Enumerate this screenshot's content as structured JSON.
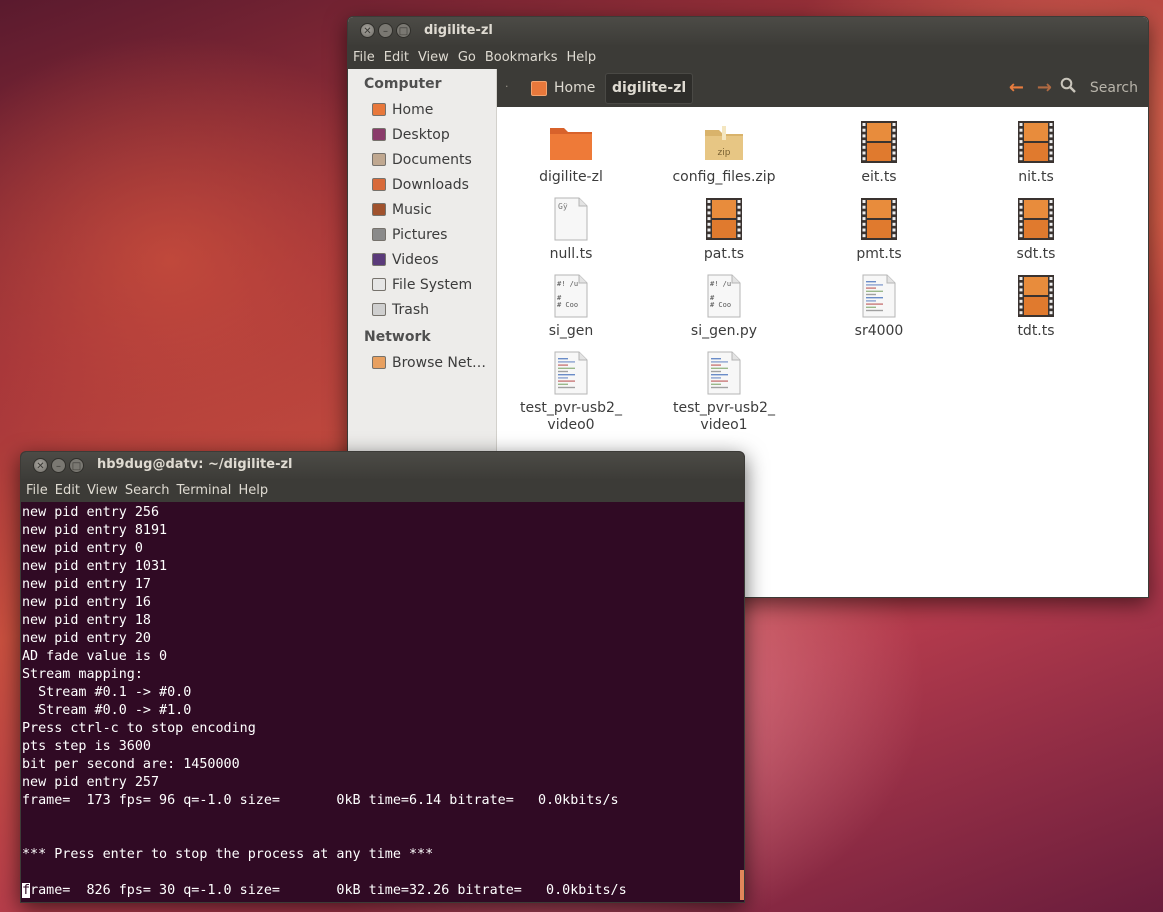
{
  "file_manager": {
    "title": "digilite-zl",
    "menu": [
      "File",
      "Edit",
      "View",
      "Go",
      "Bookmarks",
      "Help"
    ],
    "breadcrumb": {
      "home": "Home",
      "current": "digilite-zl"
    },
    "search_label": "Search",
    "sidebar": {
      "computer_heading": "Computer",
      "computer_items": [
        {
          "label": "Home",
          "icon": "home-icon"
        },
        {
          "label": "Desktop",
          "icon": "desktop-icon"
        },
        {
          "label": "Documents",
          "icon": "documents-icon"
        },
        {
          "label": "Downloads",
          "icon": "downloads-icon"
        },
        {
          "label": "Music",
          "icon": "music-icon"
        },
        {
          "label": "Pictures",
          "icon": "pictures-icon"
        },
        {
          "label": "Videos",
          "icon": "videos-icon"
        },
        {
          "label": "File System",
          "icon": "drive-icon"
        },
        {
          "label": "Trash",
          "icon": "trash-icon"
        }
      ],
      "network_heading": "Network",
      "network_items": [
        {
          "label": "Browse Net…",
          "icon": "network-icon"
        }
      ]
    },
    "files": [
      {
        "name": "digilite-zl",
        "type": "folder"
      },
      {
        "name": "config_files.zip",
        "type": "zip"
      },
      {
        "name": "eit.ts",
        "type": "video"
      },
      {
        "name": "nit.ts",
        "type": "video"
      },
      {
        "name": "null.ts",
        "type": "binary"
      },
      {
        "name": "pat.ts",
        "type": "video"
      },
      {
        "name": "pmt.ts",
        "type": "video"
      },
      {
        "name": "sdt.ts",
        "type": "video"
      },
      {
        "name": "si_gen",
        "type": "script"
      },
      {
        "name": "si_gen.py",
        "type": "script"
      },
      {
        "name": "sr4000",
        "type": "text"
      },
      {
        "name": "tdt.ts",
        "type": "video"
      },
      {
        "name": "test_pvr-usb2_\nvideo0",
        "type": "text"
      },
      {
        "name": "test_pvr-usb2_\nvideo1",
        "type": "text"
      }
    ],
    "icon_snippets": {
      "binary": "Gÿ",
      "script_line1": "#! /u",
      "script_line2": "#",
      "script_line3": "# Coo",
      "zip": "zip"
    }
  },
  "terminal": {
    "title": "hb9dug@datv: ~/digilite-zl",
    "menu": [
      "File",
      "Edit",
      "View",
      "Search",
      "Terminal",
      "Help"
    ],
    "lines": [
      "new pid entry 256",
      "new pid entry 8191",
      "new pid entry 0",
      "new pid entry 1031",
      "new pid entry 17",
      "new pid entry 16",
      "new pid entry 18",
      "new pid entry 20",
      "AD fade value is 0",
      "Stream mapping:",
      "  Stream #0.1 -> #0.0",
      "  Stream #0.0 -> #1.0",
      "Press ctrl-c to stop encoding",
      "pts step is 3600",
      "bit per second are: 1450000",
      "new pid entry 257",
      "frame=  173 fps= 96 q=-1.0 size=       0kB time=6.14 bitrate=   0.0kbits/s",
      "",
      "",
      "*** Press enter to stop the process at any time ***",
      "",
      "frame=  826 fps= 30 q=-1.0 size=       0kB time=32.26 bitrate=   0.0kbits/s"
    ],
    "cursor_char": "f",
    "colors": {
      "background": "#300a24",
      "text": "#ffffff",
      "accent": "#e87c3e"
    }
  }
}
